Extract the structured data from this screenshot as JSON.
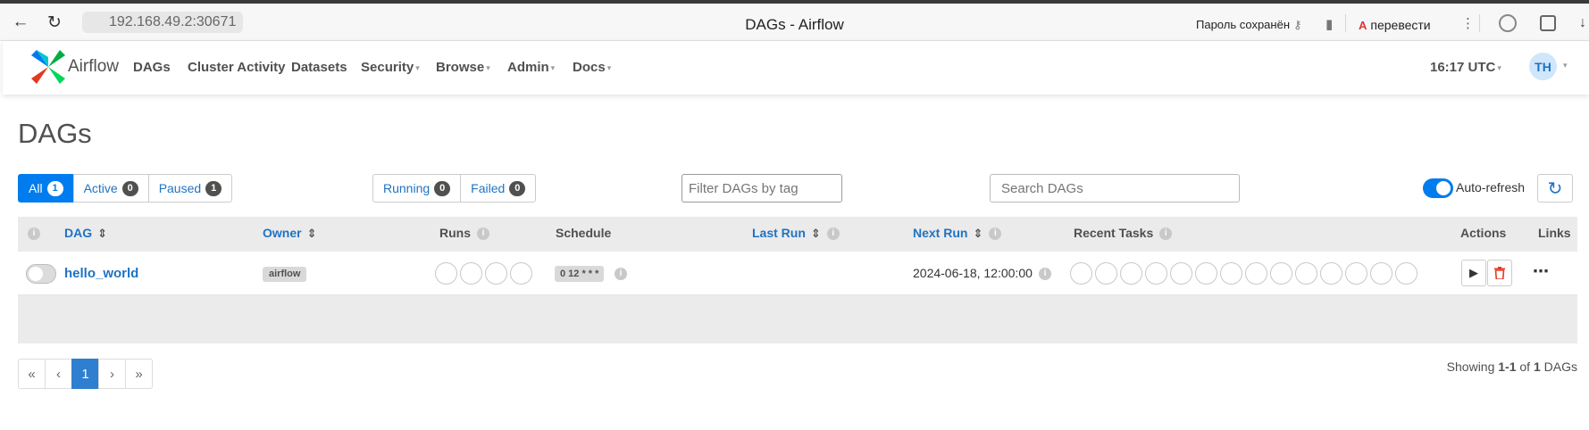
{
  "browser": {
    "url": "192.168.49.2:30671",
    "tab_title": "DAGs - Airflow",
    "password_saved": "Пароль сохранён",
    "translate_label": "перевести"
  },
  "navbar": {
    "brand": "Airflow",
    "items": [
      {
        "label": "DAGs",
        "dropdown": false
      },
      {
        "label": "Cluster Activity",
        "dropdown": false
      },
      {
        "label": "Datasets",
        "dropdown": false
      },
      {
        "label": "Security",
        "dropdown": true
      },
      {
        "label": "Browse",
        "dropdown": true
      },
      {
        "label": "Admin",
        "dropdown": true
      },
      {
        "label": "Docs",
        "dropdown": true
      }
    ],
    "clock": "16:17 UTC",
    "user_initials": "TH"
  },
  "page": {
    "title": "DAGs",
    "status_filters": [
      {
        "label": "All",
        "count": "1",
        "active": true
      },
      {
        "label": "Active",
        "count": "0",
        "active": false
      },
      {
        "label": "Paused",
        "count": "1",
        "active": false
      }
    ],
    "run_filters": [
      {
        "label": "Running",
        "count": "0"
      },
      {
        "label": "Failed",
        "count": "0"
      }
    ],
    "tag_filter_placeholder": "Filter DAGs by tag",
    "search_placeholder": "Search DAGs",
    "auto_refresh_label": "Auto-refresh",
    "auto_refresh_on": true
  },
  "table": {
    "headers": {
      "dag": "DAG",
      "owner": "Owner",
      "runs": "Runs",
      "schedule": "Schedule",
      "last_run": "Last Run",
      "next_run": "Next Run",
      "recent_tasks": "Recent Tasks",
      "actions": "Actions",
      "links": "Links"
    },
    "rows": [
      {
        "dag_id": "hello_world",
        "paused": true,
        "owner": "airflow",
        "runs_circles": 4,
        "schedule": "0 12 * * *",
        "last_run": "",
        "next_run": "2024-06-18, 12:00:00",
        "recent_task_circles": 14
      }
    ]
  },
  "pagination": {
    "first": "«",
    "prev": "‹",
    "current": "1",
    "next": "›",
    "last": "»",
    "showing_prefix": "Showing",
    "showing_range": "1-1",
    "showing_of": "of",
    "showing_total": "1",
    "showing_suffix": "DAGs"
  },
  "colors": {
    "accent": "#017cee",
    "link": "#1f73c2",
    "delete": "#e43921"
  }
}
